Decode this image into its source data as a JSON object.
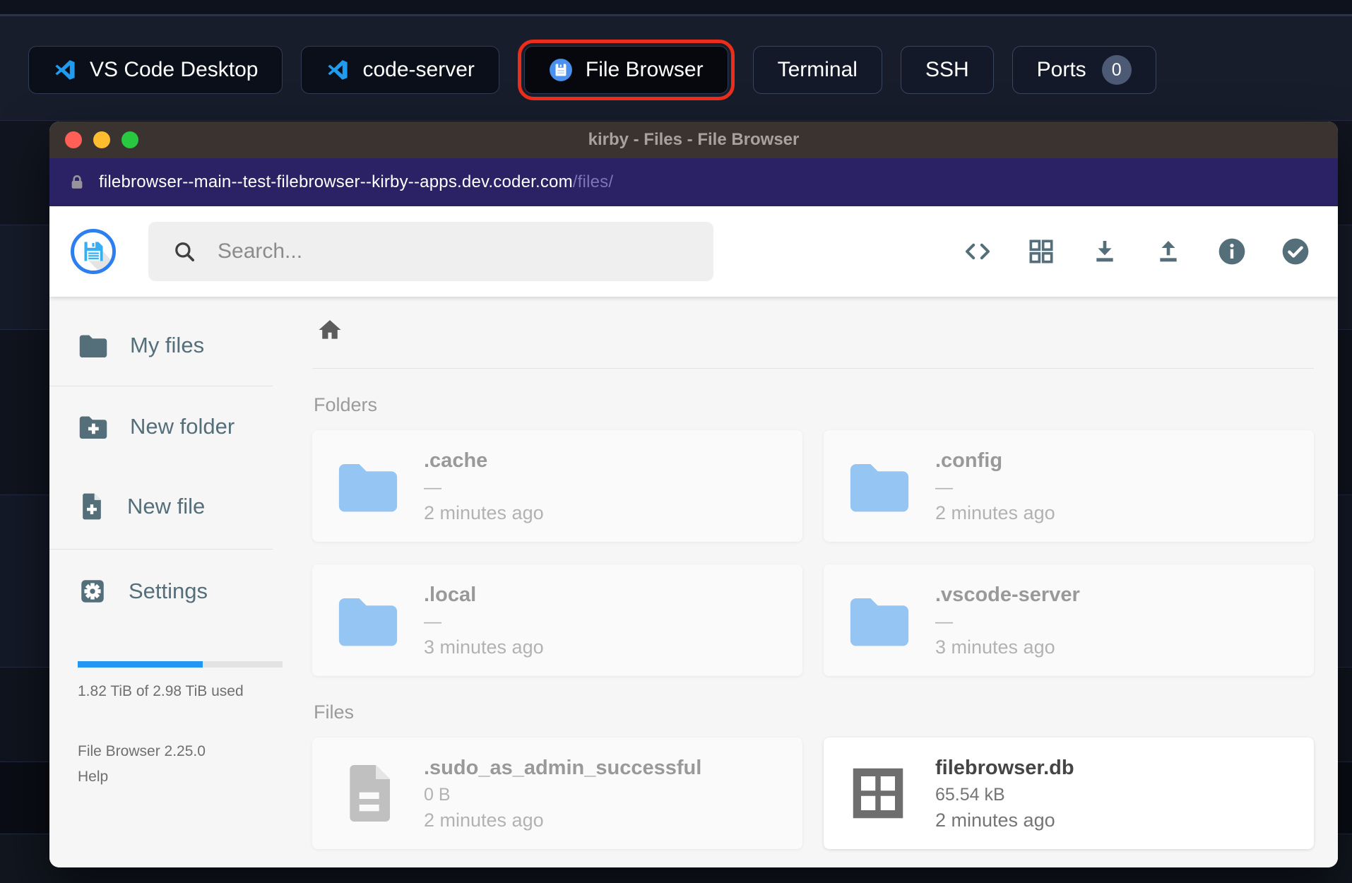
{
  "topbar": {
    "buttons": [
      {
        "label": "VS Code Desktop"
      },
      {
        "label": "code-server"
      },
      {
        "label": "File Browser",
        "highlighted": true
      },
      {
        "label": "Terminal"
      },
      {
        "label": "SSH"
      },
      {
        "label": "Ports",
        "badge": "0"
      }
    ]
  },
  "window": {
    "title": "kirby - Files - File Browser"
  },
  "urlbar": {
    "host": "filebrowser--main--test-filebrowser--kirby--apps.dev.coder.com",
    "path": "/files/"
  },
  "header": {
    "search_placeholder": "Search...",
    "action_icons": [
      "code",
      "grid-view",
      "download",
      "upload",
      "info",
      "check-circle"
    ]
  },
  "sidebar": {
    "items": [
      {
        "label": "My files",
        "icon": "folder"
      },
      {
        "label": "New folder",
        "icon": "folder-plus"
      },
      {
        "label": "New file",
        "icon": "file-plus"
      },
      {
        "label": "Settings",
        "icon": "settings"
      }
    ],
    "storage": {
      "used_label": "1.82 TiB of 2.98 TiB used",
      "percent_used": 61
    },
    "version": "File Browser 2.25.0",
    "help_label": "Help"
  },
  "content": {
    "folders_section_label": "Folders",
    "files_section_label": "Files",
    "folders": [
      {
        "name": ".cache",
        "size": "—",
        "modified": "2 minutes ago",
        "hidden": true
      },
      {
        "name": ".config",
        "size": "—",
        "modified": "2 minutes ago",
        "hidden": true
      },
      {
        "name": ".local",
        "size": "—",
        "modified": "3 minutes ago",
        "hidden": true
      },
      {
        "name": ".vscode-server",
        "size": "—",
        "modified": "3 minutes ago",
        "hidden": true
      }
    ],
    "files": [
      {
        "name": ".sudo_as_admin_successful",
        "size": "0 B",
        "modified": "2 minutes ago",
        "hidden": true
      },
      {
        "name": "filebrowser.db",
        "size": "65.54 kB",
        "modified": "2 minutes ago",
        "hidden": false
      }
    ]
  },
  "colors": {
    "accent_blue": "#2196f3",
    "slate_icon": "#546e7a",
    "highlight_ring": "#ea2e1b",
    "folder_icon_blue": "#9ecdf3",
    "url_bar": "#2a2264",
    "titlebar": "#3a332f"
  }
}
